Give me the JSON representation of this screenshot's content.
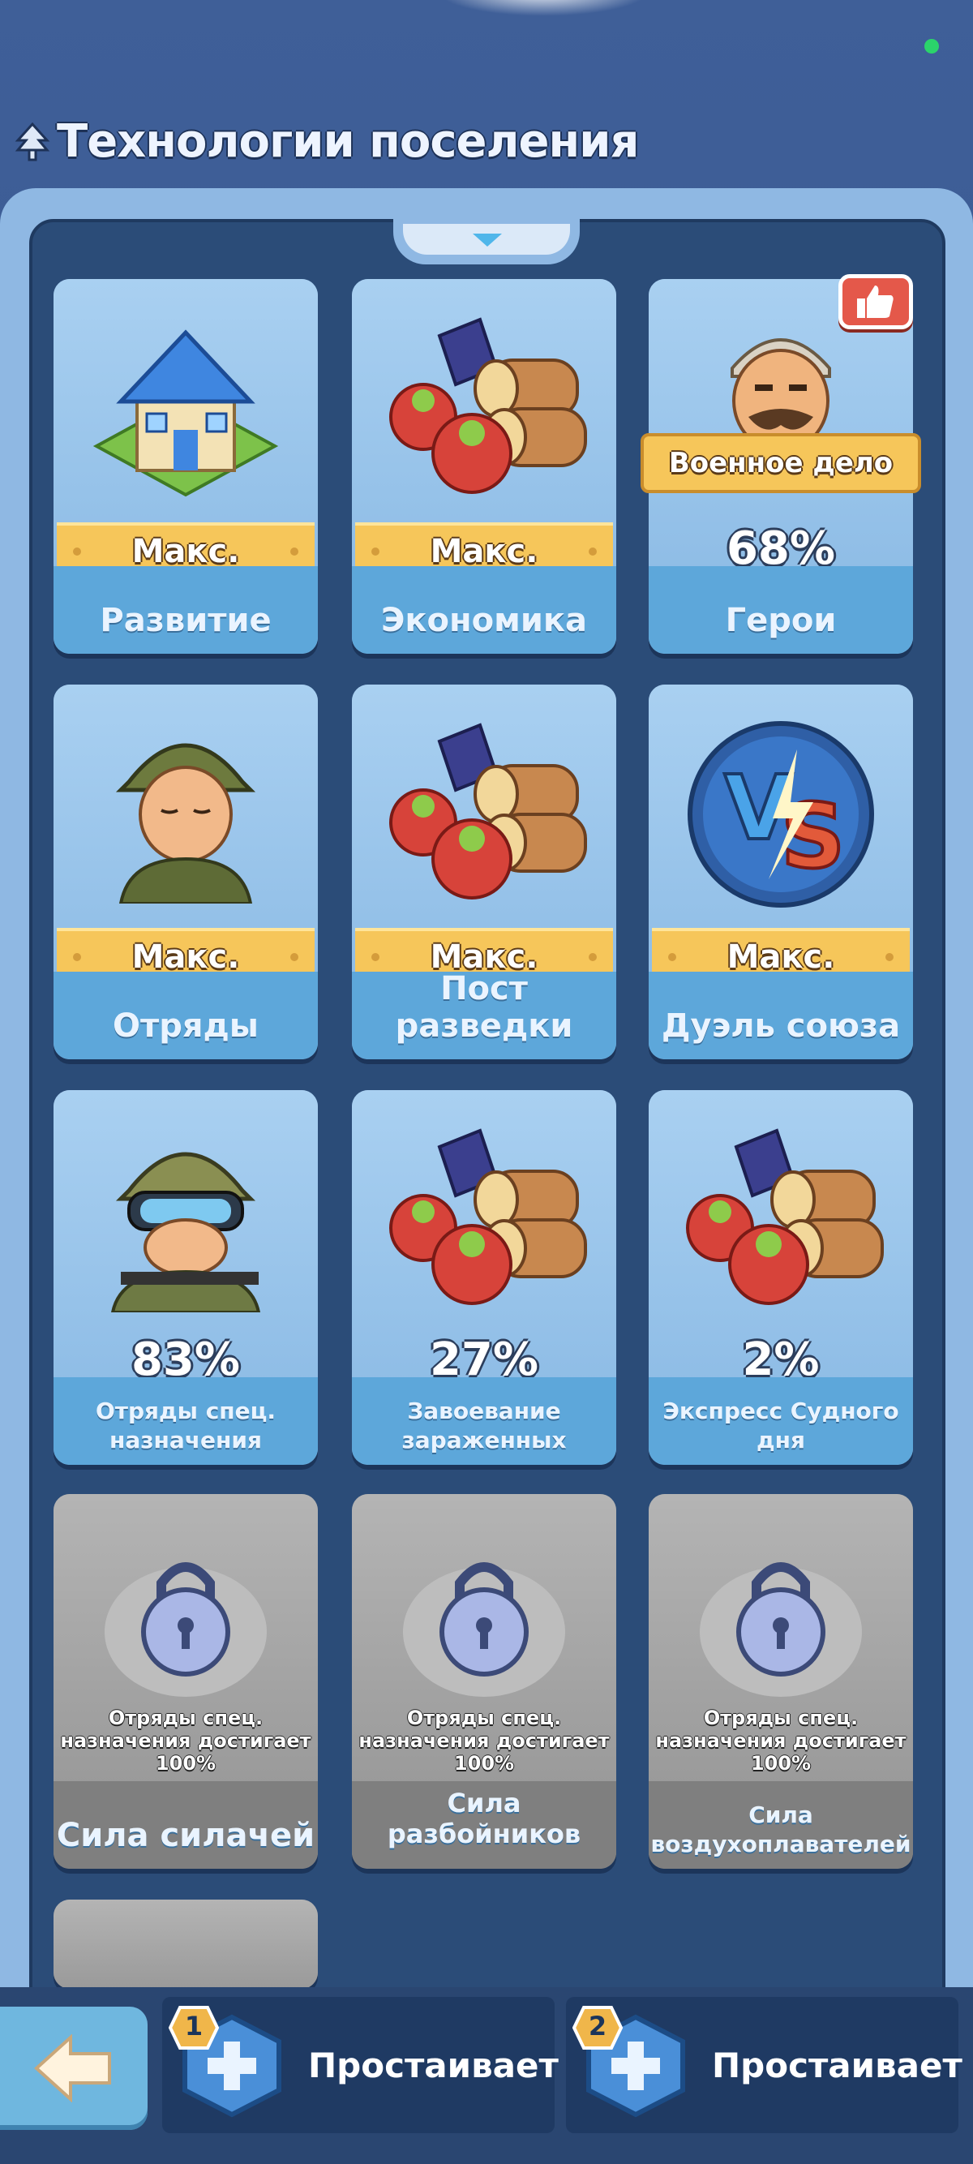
{
  "screen": {
    "title": "Технологии поселения"
  },
  "cards": [
    {
      "label": "Развитие",
      "status": "Макс.",
      "icon": "house-icon"
    },
    {
      "label": "Экономика",
      "status": "Макс.",
      "icon": "resources-icon"
    },
    {
      "label": "Герои",
      "badge": "Военное дело",
      "progress": "68%",
      "icon": "hero-icon"
    },
    {
      "label": "Отряды",
      "status": "Макс.",
      "icon": "soldier-icon"
    },
    {
      "label": "Пост разведки",
      "status": "Макс.",
      "icon": "resources-icon"
    },
    {
      "label": "Дуэль союза",
      "status": "Макс.",
      "icon": "vs-icon"
    },
    {
      "label_line1": "Отряды спец.",
      "label_line2": "назначения",
      "progress": "83%",
      "icon": "special-soldier-icon"
    },
    {
      "label_line1": "Завоевание",
      "label_line2": "зараженных",
      "progress": "27%",
      "icon": "resources-icon"
    },
    {
      "label_line1": "Экспресс Судного",
      "label_line2": "дня",
      "progress": "2%",
      "icon": "resources-icon"
    },
    {
      "label": "Сила силачей",
      "requirement_line1": "Отряды спец.",
      "requirement_line2": "назначения достигает",
      "requirement_line3": "100%",
      "locked": true,
      "icon": "lock-icon"
    },
    {
      "label": "Сила разбойников",
      "requirement_line1": "Отряды спец.",
      "requirement_line2": "назначения достигает",
      "requirement_line3": "100%",
      "locked": true,
      "icon": "lock-icon"
    },
    {
      "label_line1": "Сила",
      "label_line2": "воздухоплавателей",
      "requirement_line1": "Отряды спец.",
      "requirement_line2": "назначения достигает",
      "requirement_line3": "100%",
      "locked": true,
      "icon": "lock-icon"
    }
  ],
  "bottom": {
    "slot1_number": "1",
    "slot1_label": "Простаивает",
    "slot2_number": "2",
    "slot2_label": "Простаивает"
  },
  "colors": {
    "accent_gold": "#f6c65a",
    "card_blue": "#9fc7ea",
    "panel_dark": "#2b4c78"
  }
}
